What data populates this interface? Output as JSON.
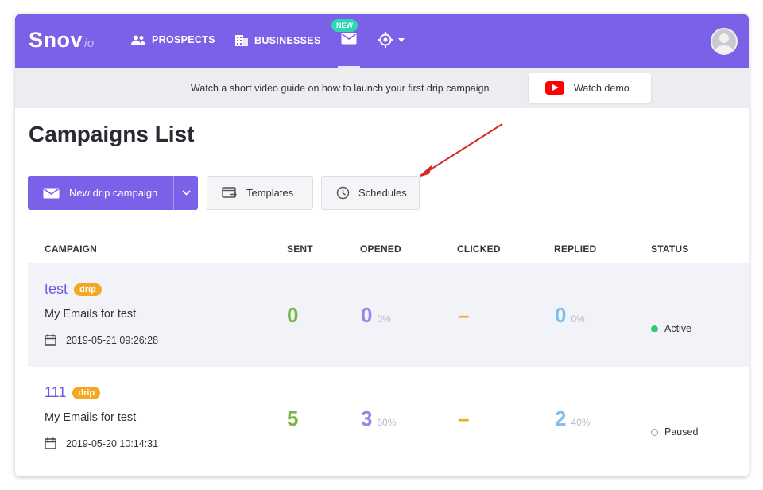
{
  "nav": {
    "logo_main": "Snov",
    "logo_suffix": "io",
    "prospects": "PROSPECTS",
    "businesses": "BUSINESSES",
    "new_badge": "NEW"
  },
  "guide": {
    "text": "Watch a short video guide on how to launch your first drip campaign",
    "watch_demo": "Watch demo"
  },
  "page": {
    "title": "Campaigns List"
  },
  "toolbar": {
    "new_campaign": "New drip campaign",
    "templates": "Templates",
    "schedules": "Schedules"
  },
  "table": {
    "headers": {
      "campaign": "CAMPAIGN",
      "sent": "SENT",
      "opened": "OPENED",
      "clicked": "CLICKED",
      "replied": "REPLIED",
      "status": "STATUS"
    },
    "rows": [
      {
        "name": "test",
        "tag": "drip",
        "list": "My Emails for test",
        "date": "2019-05-21 09:26:28",
        "sent": "0",
        "opened": "0",
        "opened_pct": "0%",
        "clicked": "–",
        "replied": "0",
        "replied_pct": "0%",
        "status": "Active"
      },
      {
        "name": "111",
        "tag": "drip",
        "list": "My Emails for test",
        "date": "2019-05-20 10:14:31",
        "sent": "5",
        "opened": "3",
        "opened_pct": "60%",
        "clicked": "–",
        "replied": "2",
        "replied_pct": "40%",
        "status": "Paused"
      }
    ]
  },
  "colors": {
    "brand": "#7b61e8",
    "sent": "#77b747",
    "opened": "#9a85e6",
    "clicked": "#f5a623",
    "replied": "#7ebdf0",
    "active": "#2ecc71",
    "arrow": "#d42a2a"
  }
}
